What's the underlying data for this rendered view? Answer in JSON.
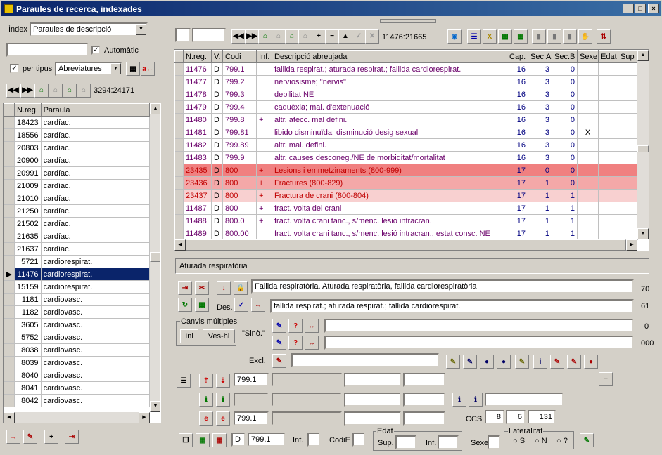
{
  "window": {
    "title": "Paraules de recerca, indexades"
  },
  "left": {
    "index_label": "Índex",
    "index_value": "Paraules de descripció",
    "automatic_label": "Automàtic",
    "automatic_checked": "✓",
    "per_tipus_label": "per tipus",
    "per_tipus_checked": "✓",
    "tipus_value": "Abreviatures",
    "counter": "3294:24171",
    "columns": [
      "N.reg.",
      "Paraula"
    ],
    "rows": [
      {
        "n": "18423",
        "p": "cardíac."
      },
      {
        "n": "18556",
        "p": "cardíac."
      },
      {
        "n": "20803",
        "p": "cardíac."
      },
      {
        "n": "20900",
        "p": "cardíac."
      },
      {
        "n": "20991",
        "p": "cardíac."
      },
      {
        "n": "21009",
        "p": "cardíac."
      },
      {
        "n": "21010",
        "p": "cardíac."
      },
      {
        "n": "21250",
        "p": "cardíac."
      },
      {
        "n": "21502",
        "p": "cardíac."
      },
      {
        "n": "21635",
        "p": "cardíac."
      },
      {
        "n": "21637",
        "p": "cardíac."
      },
      {
        "n": "5721",
        "p": "cardiorespirat."
      },
      {
        "n": "11476",
        "p": "cardiorespirat."
      },
      {
        "n": "15159",
        "p": "cardiorespirat."
      },
      {
        "n": "1181",
        "p": "cardiovasc."
      },
      {
        "n": "1182",
        "p": "cardiovasc."
      },
      {
        "n": "3605",
        "p": "cardiovasc."
      },
      {
        "n": "5752",
        "p": "cardiovasc."
      },
      {
        "n": "8038",
        "p": "cardiovasc."
      },
      {
        "n": "8039",
        "p": "cardiovasc."
      },
      {
        "n": "8040",
        "p": "cardiovasc."
      },
      {
        "n": "8041",
        "p": "cardiovasc."
      },
      {
        "n": "8042",
        "p": "cardiovasc."
      }
    ]
  },
  "right": {
    "counter": "11476:21665",
    "columns": [
      "N.reg.",
      "V.",
      "Codi",
      "Inf.",
      "Descripció abreujada",
      "Cap.",
      "Sec.A",
      "Sec.B",
      "Sexe",
      "Edat",
      "Sup"
    ],
    "rows": [
      {
        "n": "11476",
        "v": "D",
        "c": "799.1",
        "i": "",
        "d": "fallida respirat.; aturada respirat.; fallida cardiorespirat.",
        "cap": "16",
        "sa": "3",
        "sb": "0",
        "sx": "",
        "bg": "#ffffff"
      },
      {
        "n": "11477",
        "v": "D",
        "c": "799.2",
        "i": "",
        "d": "nerviosisme; \"nervis\"",
        "cap": "16",
        "sa": "3",
        "sb": "0",
        "sx": "",
        "bg": "#ffffff"
      },
      {
        "n": "11478",
        "v": "D",
        "c": "799.3",
        "i": "",
        "d": "debilitat NE",
        "cap": "16",
        "sa": "3",
        "sb": "0",
        "sx": "",
        "bg": "#ffffff"
      },
      {
        "n": "11479",
        "v": "D",
        "c": "799.4",
        "i": "",
        "d": "caquèxia; mal. d'extenuació",
        "cap": "16",
        "sa": "3",
        "sb": "0",
        "sx": "",
        "bg": "#ffffff"
      },
      {
        "n": "11480",
        "v": "D",
        "c": "799.8",
        "i": "+",
        "d": "altr. afecc. mal defini.",
        "cap": "16",
        "sa": "3",
        "sb": "0",
        "sx": "",
        "bg": "#ffffff"
      },
      {
        "n": "11481",
        "v": "D",
        "c": "799.81",
        "i": "",
        "d": "libido disminuïda; disminució desig sexual",
        "cap": "16",
        "sa": "3",
        "sb": "0",
        "sx": "X",
        "bg": "#ffffff"
      },
      {
        "n": "11482",
        "v": "D",
        "c": "799.89",
        "i": "",
        "d": "altr. mal. defini.",
        "cap": "16",
        "sa": "3",
        "sb": "0",
        "sx": "",
        "bg": "#ffffff"
      },
      {
        "n": "11483",
        "v": "D",
        "c": "799.9",
        "i": "",
        "d": "altr. causes desconeg./NE de morbiditat/mortalitat",
        "cap": "16",
        "sa": "3",
        "sb": "0",
        "sx": "",
        "bg": "#ffffff"
      },
      {
        "n": "23435",
        "v": "D",
        "c": "800",
        "i": "+",
        "d": "Lesions i emmetzinaments (800-999)",
        "cap": "17",
        "sa": "0",
        "sb": "0",
        "sx": "",
        "bg": "#f08080"
      },
      {
        "n": "23436",
        "v": "D",
        "c": "800",
        "i": "+",
        "d": "Fractures (800-829)",
        "cap": "17",
        "sa": "1",
        "sb": "0",
        "sx": "",
        "bg": "#f4a8a8"
      },
      {
        "n": "23437",
        "v": "D",
        "c": "800",
        "i": "+",
        "d": "Fractura de crani (800-804)",
        "cap": "17",
        "sa": "1",
        "sb": "1",
        "sx": "",
        "bg": "#f8d0d0"
      },
      {
        "n": "11487",
        "v": "D",
        "c": "800",
        "i": "+",
        "d": "fract. volta del crani",
        "cap": "17",
        "sa": "1",
        "sb": "1",
        "sx": "",
        "bg": "#ffffff"
      },
      {
        "n": "11488",
        "v": "D",
        "c": "800.0",
        "i": "+",
        "d": "fract. volta crani tanc., s/menc. lesió intracran.",
        "cap": "17",
        "sa": "1",
        "sb": "1",
        "sx": "",
        "bg": "#ffffff"
      },
      {
        "n": "11489",
        "v": "D",
        "c": "800.00",
        "i": "",
        "d": "fract. volta crani tanc., s/menc. lesió intracran., estat consc. NE",
        "cap": "17",
        "sa": "1",
        "sb": "1",
        "sx": "",
        "bg": "#ffffff"
      }
    ]
  },
  "detail": {
    "title": "Aturada respiratòria",
    "full_desc": "Fallida respiratòria. Aturada respiratòria, fallida cardiorespiratòria",
    "full_len": "70",
    "des_label": "Des.",
    "short_desc": "fallida respirat.; aturada respirat.; fallida cardiorespirat.",
    "short_len": "61",
    "canvis_label": "Canvis múltiples",
    "ini_label": "Ini",
    "veshi_label": "Ves-hi",
    "sino_label": "\"Sinò.\"",
    "sino1_len": "0",
    "sino2_len": "000",
    "excl_label": "Excl.",
    "code1": "799.1",
    "code3": "799.1",
    "ccs_label": "CCS",
    "ccs1": "8",
    "ccs2": "6",
    "ccs3": "131",
    "v_value": "D",
    "code_bottom": "799.1",
    "inf_label": "Inf.",
    "codie_label": "CodiE",
    "edat_label": "Edat",
    "sup_label": "Sup.",
    "inf2_label": "Inf.",
    "sexe_label": "Sexe",
    "lat_label": "Lateralitat",
    "lat_s": "S",
    "lat_n": "N",
    "lat_q": "?"
  }
}
